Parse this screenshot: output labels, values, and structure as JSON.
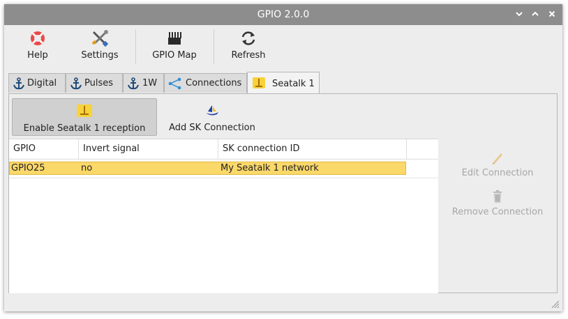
{
  "window": {
    "title": "GPIO 2.0.0"
  },
  "toolbar": {
    "help": "Help",
    "settings": "Settings",
    "gpio_map": "GPIO Map",
    "refresh": "Refresh"
  },
  "tabs": [
    {
      "label": "Digital"
    },
    {
      "label": "Pulses"
    },
    {
      "label": "1W"
    },
    {
      "label": "Connections"
    },
    {
      "label": "Seatalk 1"
    }
  ],
  "actions": {
    "enable": "Enable Seatalk 1 reception",
    "add": "Add SK Connection"
  },
  "table": {
    "columns": [
      "GPIO",
      "Invert signal",
      "SK connection ID"
    ],
    "rows": [
      {
        "gpio": "GPIO25",
        "invert": "no",
        "sk_id": "My Seatalk 1 network"
      }
    ]
  },
  "side": {
    "edit": "Edit Connection",
    "remove": "Remove Connection"
  },
  "colors": {
    "titlebar": "#8d8d8d",
    "selected_row": "#fbd86a"
  }
}
